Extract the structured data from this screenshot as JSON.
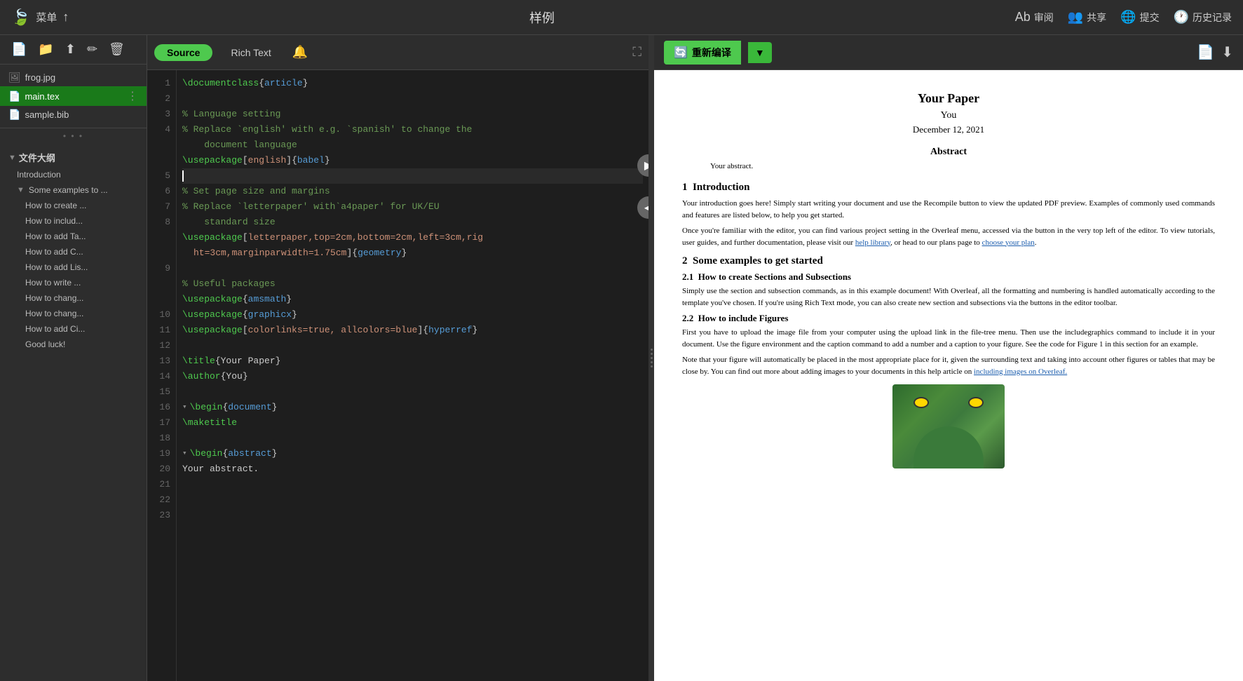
{
  "app": {
    "title": "样例",
    "logo": "🍃"
  },
  "topbar": {
    "menu_label": "菜单",
    "upload_icon": "↑",
    "review_label": "审阅",
    "share_label": "共享",
    "submit_label": "提交",
    "history_label": "历史记录"
  },
  "sidebar_toolbar": {
    "new_file": "📄",
    "new_folder": "📁",
    "upload": "⬆",
    "edit": "✏",
    "delete": "🗑"
  },
  "files": [
    {
      "name": "frog.jpg",
      "icon": "🖼",
      "type": "img",
      "active": false
    },
    {
      "name": "main.tex",
      "icon": "📄",
      "type": "tex",
      "active": true
    },
    {
      "name": "sample.bib",
      "icon": "📄",
      "type": "bib",
      "active": false
    }
  ],
  "outline": {
    "header": "文件大纲",
    "items": [
      {
        "label": "Introduction",
        "level": 0,
        "indent": "outline-item"
      },
      {
        "label": "Some examples to ...",
        "level": 0,
        "indent": "outline-item",
        "hasChildren": true
      },
      {
        "label": "How to create ...",
        "level": 1,
        "indent": "outline-item sub"
      },
      {
        "label": "How to includ...",
        "level": 1,
        "indent": "outline-item sub"
      },
      {
        "label": "How to add Ta...",
        "level": 1,
        "indent": "outline-item sub"
      },
      {
        "label": "How to add C...",
        "level": 1,
        "indent": "outline-item sub"
      },
      {
        "label": "How to add Lis...",
        "level": 1,
        "indent": "outline-item sub"
      },
      {
        "label": "How to write ...",
        "level": 1,
        "indent": "outline-item sub"
      },
      {
        "label": "How to chang...",
        "level": 1,
        "indent": "outline-item sub"
      },
      {
        "label": "How to chang...",
        "level": 1,
        "indent": "outline-item sub"
      },
      {
        "label": "How to add Ci...",
        "level": 1,
        "indent": "outline-item sub"
      },
      {
        "label": "Good luck!",
        "level": 1,
        "indent": "outline-item sub"
      }
    ]
  },
  "editor": {
    "tab_source": "Source",
    "tab_richtext": "Rich Text",
    "lines": [
      {
        "num": 1,
        "content": "\\documentclass{article}",
        "tokens": [
          {
            "t": "command",
            "v": "\\documentclass"
          },
          {
            "t": "brace",
            "v": "{"
          },
          {
            "t": "keyword",
            "v": "article"
          },
          {
            "t": "brace",
            "v": "}"
          }
        ]
      },
      {
        "num": 2,
        "content": "",
        "tokens": []
      },
      {
        "num": 3,
        "content": "% Language setting",
        "tokens": [
          {
            "t": "comment",
            "v": "% Language setting"
          }
        ]
      },
      {
        "num": 4,
        "content": "% Replace `english' with e.g. `spanish' to change the",
        "tokens": [
          {
            "t": "comment",
            "v": "% Replace `english' with e.g. `spanish' to change the"
          }
        ]
      },
      {
        "num": 4,
        "content": "document language",
        "tokens": [
          {
            "t": "comment",
            "v": "document language"
          }
        ],
        "continuation": true
      },
      {
        "num": 5,
        "content": "\\usepackage[english]{babel}",
        "tokens": [
          {
            "t": "command",
            "v": "\\usepackage"
          },
          {
            "t": "brace",
            "v": "["
          },
          {
            "t": "option",
            "v": "english"
          },
          {
            "t": "brace",
            "v": "]"
          },
          {
            "t": "brace",
            "v": "{"
          },
          {
            "t": "keyword",
            "v": "babel"
          },
          {
            "t": "brace",
            "v": "}"
          }
        ]
      },
      {
        "num": 6,
        "content": "",
        "tokens": [],
        "cursor": true
      },
      {
        "num": 7,
        "content": "% Set page size and margins",
        "tokens": [
          {
            "t": "comment",
            "v": "% Set page size and margins"
          }
        ]
      },
      {
        "num": 8,
        "content": "% Replace `letterpaper' with`a4paper' for UK/EU",
        "tokens": [
          {
            "t": "comment",
            "v": "% Replace `letterpaper' with`a4paper' for UK/EU"
          }
        ]
      },
      {
        "num": 8,
        "content": "standard size",
        "tokens": [
          {
            "t": "comment",
            "v": "standard size"
          }
        ],
        "continuation": true
      },
      {
        "num": 9,
        "content": "\\usepackage[letterpaper,top=2cm,bottom=2cm,left=3cm,right=3cm,marginparwidth=1.75cm]{geometry}",
        "tokens": [
          {
            "t": "command",
            "v": "\\usepackage"
          },
          {
            "t": "brace",
            "v": "["
          },
          {
            "t": "option",
            "v": "letterpaper,top=2cm,bottom=2cm,left=3cm,rig"
          },
          {
            "t": "nl",
            "v": ""
          },
          {
            "t": "option",
            "v": "ht=3cm,marginparwidth=1.75cm"
          },
          {
            "t": "brace",
            "v": "]"
          },
          {
            "t": "brace",
            "v": "{"
          },
          {
            "t": "keyword",
            "v": "geometry"
          },
          {
            "t": "brace",
            "v": "}"
          }
        ]
      },
      {
        "num": 10,
        "content": "",
        "tokens": []
      },
      {
        "num": 11,
        "content": "% Useful packages",
        "tokens": [
          {
            "t": "comment",
            "v": "% Useful packages"
          }
        ]
      },
      {
        "num": 12,
        "content": "\\usepackage{amsmath}",
        "tokens": [
          {
            "t": "command",
            "v": "\\usepackage"
          },
          {
            "t": "brace",
            "v": "{"
          },
          {
            "t": "keyword",
            "v": "amsmath"
          },
          {
            "t": "brace",
            "v": "}"
          }
        ]
      },
      {
        "num": 13,
        "content": "\\usepackage{graphicx}",
        "tokens": [
          {
            "t": "command",
            "v": "\\usepackage"
          },
          {
            "t": "brace",
            "v": "{"
          },
          {
            "t": "keyword",
            "v": "graphicx"
          },
          {
            "t": "brace",
            "v": "}"
          }
        ]
      },
      {
        "num": 14,
        "content": "\\usepackage[colorlinks=true, allcolors=blue]{hyperref}",
        "tokens": [
          {
            "t": "command",
            "v": "\\usepackage"
          },
          {
            "t": "brace",
            "v": "["
          },
          {
            "t": "option",
            "v": "colorlinks=true, allcolors=blue"
          },
          {
            "t": "brace",
            "v": "]"
          },
          {
            "t": "brace",
            "v": "{"
          },
          {
            "t": "keyword",
            "v": "hyperref"
          },
          {
            "t": "brace",
            "v": "}"
          }
        ]
      },
      {
        "num": 15,
        "content": "",
        "tokens": []
      },
      {
        "num": 16,
        "content": "\\title{Your Paper}",
        "tokens": [
          {
            "t": "command",
            "v": "\\title"
          },
          {
            "t": "brace",
            "v": "{"
          },
          {
            "t": "normal",
            "v": "Your Paper"
          },
          {
            "t": "brace",
            "v": "}"
          }
        ]
      },
      {
        "num": 17,
        "content": "\\author{You}",
        "tokens": [
          {
            "t": "command",
            "v": "\\author"
          },
          {
            "t": "brace",
            "v": "{"
          },
          {
            "t": "normal",
            "v": "You"
          },
          {
            "t": "brace",
            "v": "}"
          }
        ]
      },
      {
        "num": 18,
        "content": "",
        "tokens": []
      },
      {
        "num": 19,
        "content": "\\begin{document}",
        "tokens": [
          {
            "t": "command",
            "v": "\\begin"
          },
          {
            "t": "brace",
            "v": "{"
          },
          {
            "t": "keyword",
            "v": "document"
          },
          {
            "t": "brace",
            "v": "}"
          }
        ],
        "fold": true
      },
      {
        "num": 20,
        "content": "\\maketitle",
        "tokens": [
          {
            "t": "command",
            "v": "\\maketitle"
          }
        ]
      },
      {
        "num": 21,
        "content": "",
        "tokens": []
      },
      {
        "num": 22,
        "content": "\\begin{abstract}",
        "tokens": [
          {
            "t": "command",
            "v": "\\begin"
          },
          {
            "t": "brace",
            "v": "{"
          },
          {
            "t": "keyword",
            "v": "abstract"
          },
          {
            "t": "brace",
            "v": "}"
          }
        ],
        "fold": true
      },
      {
        "num": 23,
        "content": "Your abstract.",
        "tokens": [
          {
            "t": "normal",
            "v": "Your abstract."
          }
        ]
      }
    ]
  },
  "preview": {
    "recompile_label": "重新编译",
    "paper": {
      "title": "Your Paper",
      "author": "You",
      "date": "December 12, 2021",
      "abstract_title": "Abstract",
      "abstract_text": "Your abstract.",
      "section1_num": "1",
      "section1_title": "Introduction",
      "section1_body": "Your introduction goes here! Simply start writing your document and use the Recompile button to view the updated PDF preview. Examples of commonly used commands and features are listed below, to help you get started.",
      "section1_body2": "Once you're familiar with the editor, you can find various project setting in the Overleaf menu, accessed via the button in the very top left of the editor. To view tutorials, user guides, and further documentation, please visit our help library, or head to our plans page to choose your plan.",
      "section2_num": "2",
      "section2_title": "Some examples to get started",
      "sub21_num": "2.1",
      "sub21_title": "How to create Sections and Subsections",
      "sub21_body": "Simply use the section and subsection commands, as in this example document! With Overleaf, all the formatting and numbering is handled automatically according to the template you've chosen. If you're using Rich Text mode, you can also create new section and subsections via the buttons in the editor toolbar.",
      "sub22_num": "2.2",
      "sub22_title": "How to include Figures",
      "sub22_body": "First you have to upload the image file from your computer using the upload link in the file-tree menu. Then use the includegraphics command to include it in your document. Use the figure environment and the caption command to add a number and a caption to your figure. See the code for Figure 1 in this section for an example.",
      "sub22_body2": "Note that your figure will automatically be placed in the most appropriate place for it, given the surrounding text and taking into account other figures or tables that may be close by. You can find out more about adding images to your documents in this help article on including images on Overleaf."
    }
  }
}
